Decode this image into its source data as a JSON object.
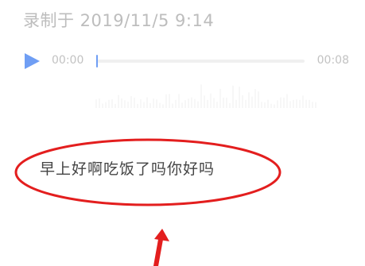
{
  "recording": {
    "recorded_at": "录制于 2019/11/5 9:14",
    "current_time": "00:00",
    "total_time": "00:08",
    "progress": 0.0
  },
  "transcript": {
    "text": "早上好啊吃饭了吗你好吗"
  },
  "colors": {
    "accent": "#6f9ef4",
    "annotation": "#e31e1e",
    "muted_text": "#bdbdbd",
    "body_text": "#444444"
  },
  "icons": {
    "play": "play-icon"
  }
}
